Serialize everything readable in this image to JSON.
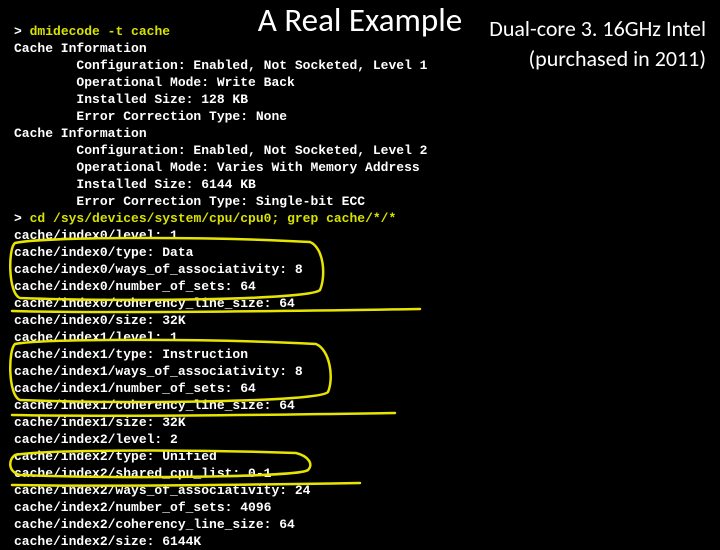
{
  "title": "A Real Example",
  "subtitle_line1": "Dual-core 3. 16GHz Intel",
  "subtitle_line2": "(purchased in 2011)",
  "prompt": ">",
  "cmd1": "dmidecode -t cache",
  "dm": {
    "h1": "Cache Information",
    "c1l1": "        Configuration: Enabled, Not Socketed, Level 1",
    "c1l2": "        Operational Mode: Write Back",
    "c1l3": "        Installed Size: 128 KB",
    "c1l4": "        Error Correction Type: None",
    "h2": "Cache Information",
    "c2l1": "        Configuration: Enabled, Not Socketed, Level 2",
    "c2l2": "        Operational Mode: Varies With Memory Address",
    "c2l3": "        Installed Size: 6144 KB",
    "c2l4": "        Error Correction Type: Single-bit ECC"
  },
  "cmd2": "cd /sys/devices/system/cpu/cpu0; grep cache/*/*",
  "sys": {
    "l01": "cache/index0/level: 1",
    "l02": "cache/index0/type: Data",
    "l03": "cache/index0/ways_of_associativity: 8",
    "l04": "cache/index0/number_of_sets: 64",
    "l05": "cache/index0/coherency_line_size: 64",
    "l06": "cache/index0/size: 32K",
    "l07": "cache/index1/level: 1",
    "l08": "cache/index1/type: Instruction",
    "l09": "cache/index1/ways_of_associativity: 8",
    "l10": "cache/index1/number_of_sets: 64",
    "l11": "cache/index1/coherency_line_size: 64",
    "l12": "cache/index1/size: 32K",
    "l13": "cache/index2/level: 2",
    "l14": "cache/index2/type: Unified",
    "l15": "cache/index2/shared_cpu_list: 0-1",
    "l16": "cache/index2/ways_of_associativity: 24",
    "l17": "cache/index2/number_of_sets: 4096",
    "l18": "cache/index2/coherency_line_size: 64",
    "l19": "cache/index2/size: 6144K"
  }
}
